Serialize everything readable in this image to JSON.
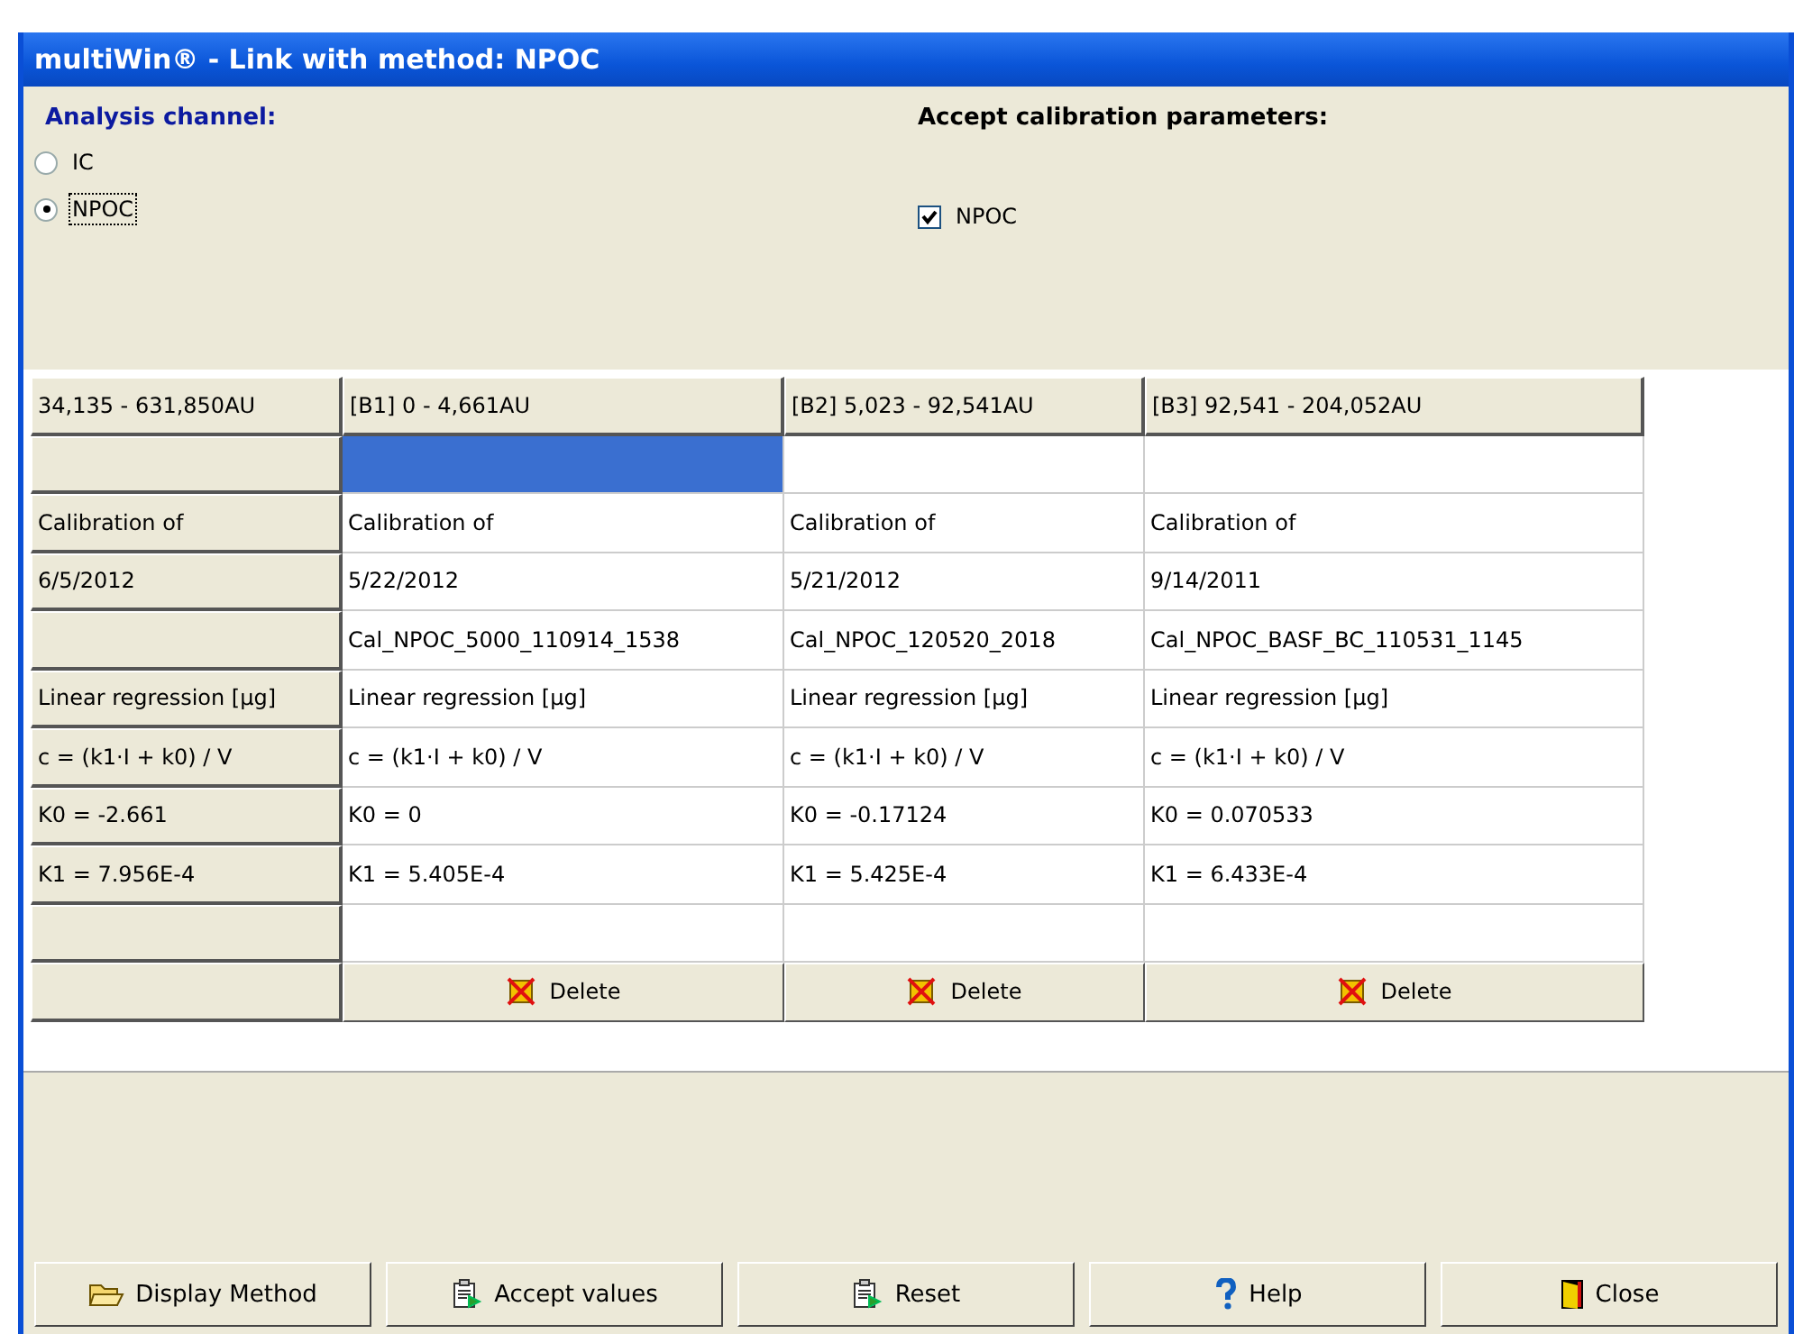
{
  "window": {
    "title": "multiWin® - Link with method: NPOC"
  },
  "analysis_channel": {
    "label": "Analysis channel:",
    "options": [
      {
        "label": "IC",
        "selected": false
      },
      {
        "label": "NPOC",
        "selected": true
      }
    ]
  },
  "accept_calibration": {
    "label": "Accept calibration parameters:",
    "options": [
      {
        "label": "NPOC",
        "checked": true
      }
    ]
  },
  "grid": {
    "header": [
      "34,135  -  631,850AU",
      "[B1] 0  -  4,661AU",
      "[B2] 5,023  -  92,541AU",
      "[B3] 92,541  -  204,052AU"
    ],
    "rows": [
      {
        "kind": "selection",
        "cells": [
          {
            "selected": true
          },
          {
            "selected": false
          },
          {
            "selected": false
          }
        ]
      },
      {
        "kind": "values",
        "label": "Calibration of",
        "cells": [
          "Calibration of",
          "Calibration of",
          "Calibration of"
        ]
      },
      {
        "kind": "values",
        "label": "6/5/2012",
        "cells": [
          "5/22/2012",
          "5/21/2012",
          "9/14/2011"
        ]
      },
      {
        "kind": "values",
        "cells": [
          "Cal_NPOC_5000_110914_1538",
          "Cal_NPOC_120520_2018",
          "Cal_NPOC_BASF_BC_110531_1145"
        ]
      },
      {
        "kind": "values",
        "label": "Linear regression [µg]",
        "cells": [
          "Linear regression [µg]",
          "Linear regression [µg]",
          "Linear regression [µg]"
        ]
      },
      {
        "kind": "values",
        "label": "c = (k1·I + k0) / V",
        "cells": [
          "c = (k1·I + k0) / V",
          "c = (k1·I + k0) / V",
          "c = (k1·I + k0) / V"
        ]
      },
      {
        "kind": "values",
        "label": "K0 = -2.661",
        "cells": [
          "K0 = 0",
          "K0 = -0.17124",
          "K0 = 0.070533"
        ]
      },
      {
        "kind": "values",
        "label": "K1 = 7.956E-4",
        "cells": [
          "K1 = 5.405E-4",
          "K1 = 5.425E-4",
          "K1 = 6.433E-4"
        ]
      },
      {
        "kind": "values"
      },
      {
        "kind": "actions",
        "buttons": [
          "Delete",
          "Delete",
          "Delete"
        ]
      }
    ]
  },
  "buttons": [
    {
      "label": "Display Method",
      "kind": "folder"
    },
    {
      "label": "Accept values",
      "kind": "clipboard"
    },
    {
      "label": "Reset",
      "kind": "clipboard"
    },
    {
      "label": "Help",
      "kind": "question"
    },
    {
      "label": "Close",
      "kind": "door"
    }
  ]
}
